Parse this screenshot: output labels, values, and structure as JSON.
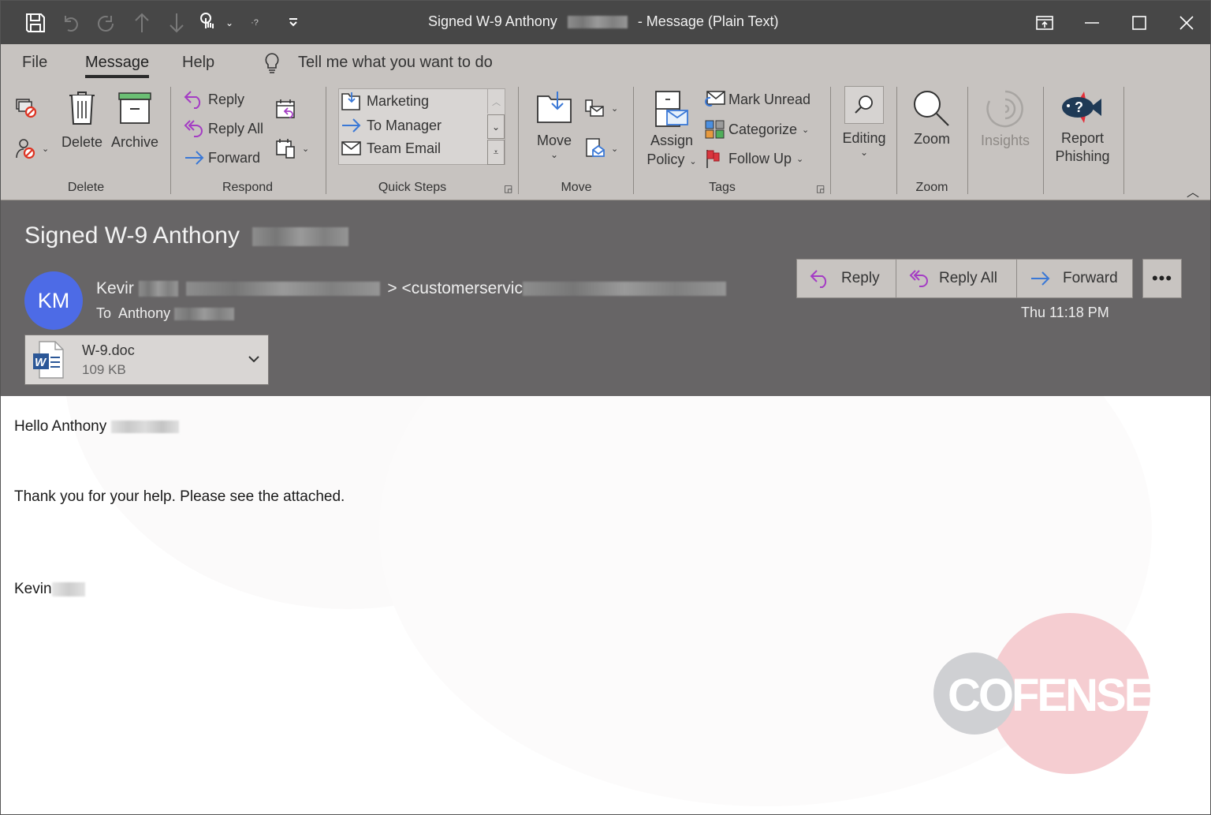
{
  "window": {
    "title_prefix": "Signed W-9 Anthony",
    "title_suffix": "-  Message (Plain Text)",
    "quick_access": [
      "save-icon",
      "undo-icon",
      "redo-icon",
      "up-icon",
      "down-icon",
      "touch-mode-icon",
      "customize-icon"
    ],
    "controls": [
      "ribbon-display-options-icon",
      "minimize-icon",
      "maximize-icon",
      "close-icon"
    ]
  },
  "ribbon_tabs": [
    {
      "label": "File",
      "active": false
    },
    {
      "label": "Message",
      "active": true
    },
    {
      "label": "Help",
      "active": false
    }
  ],
  "tell_me": "Tell me what you want to do",
  "ribbon": {
    "delete_group": {
      "label": "Delete",
      "delete": "Delete",
      "archive": "Archive"
    },
    "respond_group": {
      "label": "Respond",
      "reply": "Reply",
      "reply_all": "Reply All",
      "forward": "Forward"
    },
    "quick_steps_group": {
      "label": "Quick Steps",
      "items": [
        "Marketing",
        "To Manager",
        "Team Email"
      ]
    },
    "move_group": {
      "label": "Move",
      "move": "Move"
    },
    "tags_group": {
      "label": "Tags",
      "assign_policy_1": "Assign",
      "assign_policy_2": "Policy",
      "mark_unread": "Mark Unread",
      "categorize": "Categorize",
      "follow_up": "Follow Up"
    },
    "editing": {
      "label": "Editing"
    },
    "zoom_group": {
      "label": "Zoom",
      "zoom": "Zoom"
    },
    "insights": {
      "label": "Insights"
    },
    "report_phishing": {
      "label_1": "Report",
      "label_2": "Phishing"
    }
  },
  "message": {
    "subject": "Signed W-9 Anthony",
    "avatar_initials": "KM",
    "sender_name": "Kevir",
    "sender_email_prefix": "<customerservic",
    "to_label": "To",
    "to_name": "Anthony",
    "date": "Thu 11:18 PM",
    "actions": {
      "reply": "Reply",
      "reply_all": "Reply All",
      "forward": "Forward",
      "more": "•••"
    },
    "attachment": {
      "name": "W-9.doc",
      "size": "109 KB"
    }
  },
  "body": {
    "greeting": "Hello Anthony",
    "line1": "Thank you for your help. Please see the attached.",
    "signature": "Kevin"
  },
  "watermark": {
    "brand": "COFENSE",
    "colors": {
      "gray": "#cfd0d3",
      "pink": "#f5cdd1"
    }
  },
  "colors": {
    "titlebar": "#474747",
    "ribbon": "#c7c3c0",
    "header": "#676566",
    "avatar": "#4d6be6",
    "reply_purple": "#a43cc4",
    "forward_blue": "#3a78d6"
  }
}
